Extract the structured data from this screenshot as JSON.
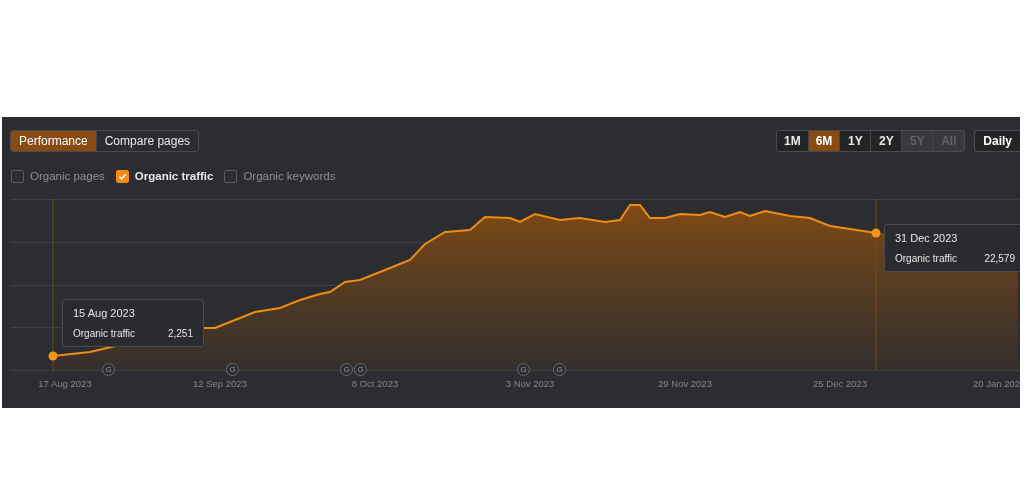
{
  "view_toggle": [
    {
      "label": "Performance",
      "selected": true
    },
    {
      "label": "Compare pages",
      "selected": false
    }
  ],
  "metrics": [
    {
      "label": "Organic pages",
      "checked": false
    },
    {
      "label": "Organic traffic",
      "checked": true
    },
    {
      "label": "Organic keywords",
      "checked": false
    }
  ],
  "ranges": [
    {
      "label": "1M",
      "selected": false,
      "disabled": false
    },
    {
      "label": "6M",
      "selected": true,
      "disabled": false
    },
    {
      "label": "1Y",
      "selected": false,
      "disabled": false
    },
    {
      "label": "2Y",
      "selected": false,
      "disabled": false
    },
    {
      "label": "5Y",
      "selected": false,
      "disabled": true
    },
    {
      "label": "All",
      "selected": false,
      "disabled": true
    }
  ],
  "interval": "Daily",
  "chart": {
    "x_labels": [
      "17 Aug 2023",
      "12 Sep 2023",
      "8 Oct 2023",
      "3 Nov 2023",
      "29 Nov 2023",
      "25 Dec 2023",
      "20 Jan 202"
    ],
    "markers": [
      "G",
      "G",
      "G",
      "G",
      "G",
      "G"
    ],
    "tooltips": [
      {
        "date": "15 Aug 2023",
        "metric": "Organic traffic",
        "value": "2,251"
      },
      {
        "date": "31 Dec 2023",
        "metric": "Organic traffic",
        "value": "22,579"
      }
    ]
  }
}
